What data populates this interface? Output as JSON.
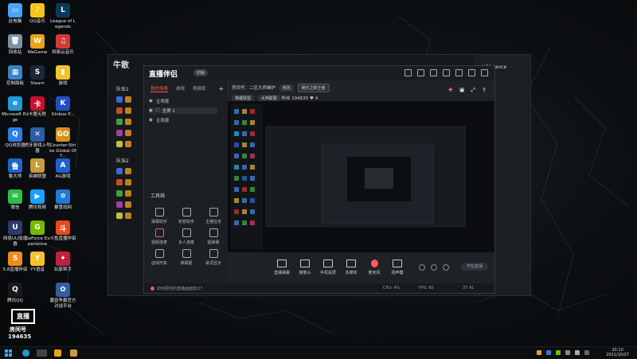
{
  "desktop_icons": [
    {
      "label": "此电脑",
      "color": "#4aa3ff",
      "glyph": "▭",
      "col": 0,
      "row": 0
    },
    {
      "label": "回收站",
      "color": "#7f8fa6",
      "glyph": "🗑",
      "col": 0,
      "row": 1
    },
    {
      "label": "控制面板",
      "color": "#3b82c4",
      "glyph": "▦",
      "col": 0,
      "row": 2
    },
    {
      "label": "Microsoft Edge",
      "color": "#1f9ad6",
      "glyph": "e",
      "col": 0,
      "row": 3
    },
    {
      "label": "QQ浏览器",
      "color": "#2a7de1",
      "glyph": "Q",
      "col": 0,
      "row": 4
    },
    {
      "label": "鲁大师",
      "color": "#1e66c8",
      "glyph": "鲁",
      "col": 0,
      "row": 5
    },
    {
      "label": "微信",
      "color": "#2bbf4a",
      "glyph": "✉",
      "col": 0,
      "row": 6
    },
    {
      "label": "网易UU加速器",
      "color": "#2a3b6a",
      "glyph": "U",
      "col": 0,
      "row": 7
    },
    {
      "label": "5.8直播伴侣",
      "color": "#f08c1a",
      "glyph": "5",
      "col": 0,
      "row": 8
    },
    {
      "label": "腾讯QQ",
      "color": "#1a1a1a",
      "glyph": "Q",
      "col": 0,
      "row": 9
    },
    {
      "label": "QQ音乐",
      "color": "#f5c518",
      "glyph": "♪",
      "col": 1,
      "row": 0
    },
    {
      "label": "WeGame",
      "color": "#e8a317",
      "glyph": "W",
      "col": 1,
      "row": 1
    },
    {
      "label": "Steam",
      "color": "#1b2838",
      "glyph": "S",
      "col": 1,
      "row": 2
    },
    {
      "label": "卡盟无税",
      "color": "#c8102e",
      "glyph": "卡",
      "col": 1,
      "row": 3
    },
    {
      "label": "虎牙游戏上号器",
      "color": "#2b5ea7",
      "glyph": "✕",
      "col": 1,
      "row": 4
    },
    {
      "label": "英雄联盟",
      "color": "#c89b3c",
      "glyph": "L",
      "col": 1,
      "row": 5
    },
    {
      "label": "腾讯视频",
      "color": "#1aa1ff",
      "glyph": "▶",
      "col": 1,
      "row": 6
    },
    {
      "label": "GeForce Experience",
      "color": "#76b900",
      "glyph": "G",
      "col": 1,
      "row": 7
    },
    {
      "label": "YY语音",
      "color": "#f6c22b",
      "glyph": "Y",
      "col": 1,
      "row": 8
    },
    {
      "label": "League of Legends",
      "color": "#0a3a5a",
      "glyph": "L",
      "col": 2,
      "row": 0
    },
    {
      "label": "网易云音乐",
      "color": "#d33a31",
      "glyph": "♫",
      "col": 2,
      "row": 1
    },
    {
      "label": "游戏",
      "color": "#f2c230",
      "glyph": "▮",
      "col": 2,
      "row": 2
    },
    {
      "label": "Kinbox P...",
      "color": "#2050c0",
      "glyph": "K",
      "col": 2,
      "row": 3
    },
    {
      "label": "Counter-Strike Global Off...",
      "color": "#d98f1a",
      "glyph": "GO",
      "col": 2,
      "row": 4
    },
    {
      "label": "AG游戏",
      "color": "#2060d0",
      "glyph": "A",
      "col": 2,
      "row": 5
    },
    {
      "label": "暴雪战网",
      "color": "#1e7ad8",
      "glyph": "✲",
      "col": 2,
      "row": 6
    },
    {
      "label": "斗鱼直播伴侣",
      "color": "#e84a1a",
      "glyph": "斗",
      "col": 2,
      "row": 7
    },
    {
      "label": "玩家帮手",
      "color": "#c02040",
      "glyph": "✦",
      "col": 2,
      "row": 8
    },
    {
      "label": "魔兽争霸官方对战平台",
      "color": "#3060a0",
      "glyph": "✿",
      "col": 2,
      "row": 9
    }
  ],
  "back_window": {
    "title": "牛散",
    "section1": "队伍1",
    "section2": "队伍2",
    "right_header": "| Distance"
  },
  "app": {
    "name": "直播伴侣",
    "version": "旧版",
    "tabs": [
      "我的场景",
      "游戏",
      "视频库"
    ],
    "scenes": [
      "主场景",
      "全屏 1",
      "主场景"
    ],
    "tools_title": "工具箱",
    "tools": [
      {
        "label": "弹幕助手",
        "red": false
      },
      {
        "label": "房管助手",
        "red": false
      },
      {
        "label": "主播任务",
        "red": false
      },
      {
        "label": "视频连麦",
        "red": true
      },
      {
        "label": "多人连麦",
        "red": false
      },
      {
        "label": "超弹幕",
        "red": false
      },
      {
        "label": "虚拟形象",
        "red": false
      },
      {
        "label": "弹幕姬",
        "red": false
      },
      {
        "label": "歌词显示",
        "red": false
      }
    ],
    "stream_info": {
      "prefix": "房间号：",
      "title": "二区大师峰护",
      "edit_label": "修改",
      "category": "娱乐之新王者",
      "tag1": "英雄联盟",
      "tag2": "大神联赛",
      "fans_label": "粉丝",
      "fans": "194635",
      "likes": "4"
    },
    "controls": [
      {
        "label": "直播弹幕",
        "red": false
      },
      {
        "label": "摄像头",
        "red": false
      },
      {
        "label": "手机投屏",
        "red": false
      },
      {
        "label": "多媒体",
        "red": false
      },
      {
        "label": "麦克风",
        "red": true
      },
      {
        "label": "扬声器",
        "red": false
      }
    ],
    "start_button": "开始直播",
    "tip": "如何把你的直播画面放大？",
    "status_left": "CPU: 4%",
    "status_mid": "FPS: 60",
    "status_right": "00:00:00",
    "status_coin": "37.41",
    "status_fps_right": "999"
  },
  "overlay": {
    "logo": "直播",
    "label": "房间号",
    "number": "194635"
  },
  "taskbar": {
    "time": "20:10",
    "date": "2021/10/27"
  }
}
